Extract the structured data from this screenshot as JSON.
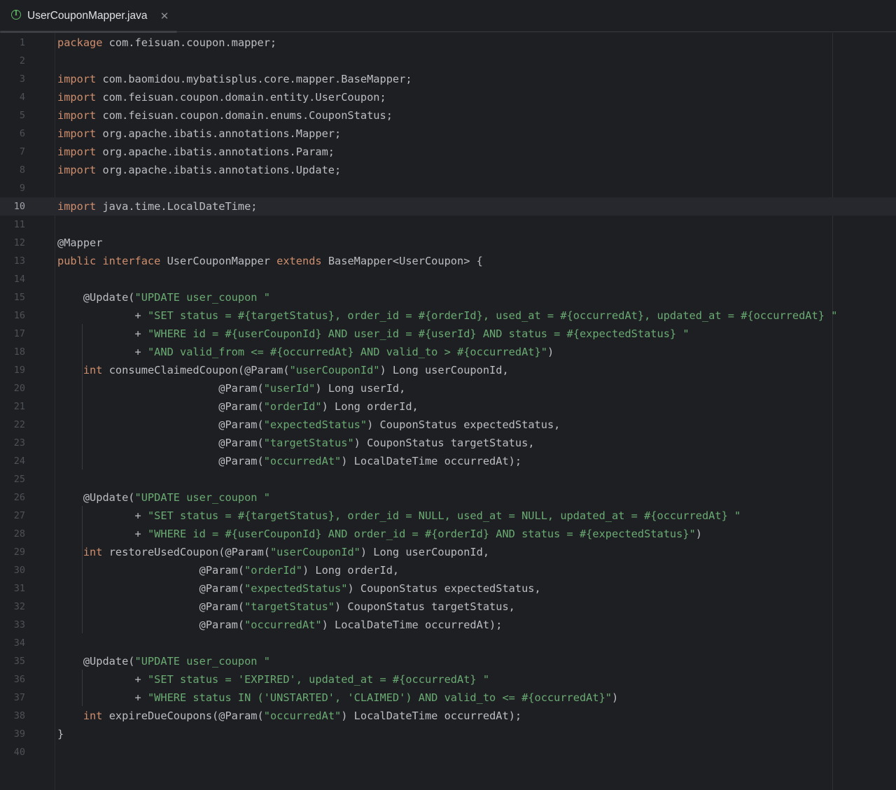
{
  "tab": {
    "title": "UserCouponMapper.java",
    "icon": "interface-icon",
    "icon_glyph": "I",
    "close_glyph": "✕"
  },
  "editor": {
    "current_line": 10,
    "lines": [
      [
        [
          "kw",
          "package"
        ],
        [
          "plain",
          " com.feisuan.coupon.mapper;"
        ]
      ],
      [],
      [
        [
          "kw",
          "import"
        ],
        [
          "plain",
          " com.baomidou.mybatisplus.core.mapper.BaseMapper;"
        ]
      ],
      [
        [
          "kw",
          "import"
        ],
        [
          "plain",
          " com.feisuan.coupon.domain.entity.UserCoupon;"
        ]
      ],
      [
        [
          "kw",
          "import"
        ],
        [
          "plain",
          " com.feisuan.coupon.domain.enums.CouponStatus;"
        ]
      ],
      [
        [
          "kw",
          "import"
        ],
        [
          "plain",
          " org.apache.ibatis.annotations.Mapper;"
        ]
      ],
      [
        [
          "kw",
          "import"
        ],
        [
          "plain",
          " org.apache.ibatis.annotations.Param;"
        ]
      ],
      [
        [
          "kw",
          "import"
        ],
        [
          "plain",
          " org.apache.ibatis.annotations.Update;"
        ]
      ],
      [],
      [
        [
          "kw",
          "import"
        ],
        [
          "plain",
          " java.time.LocalDateTime;"
        ]
      ],
      [],
      [
        [
          "plain",
          "@Mapper"
        ]
      ],
      [
        [
          "kw",
          "public interface"
        ],
        [
          "plain",
          " UserCouponMapper "
        ],
        [
          "kw",
          "extends"
        ],
        [
          "plain",
          " BaseMapper<UserCoupon> {"
        ]
      ],
      [],
      [
        [
          "plain",
          "    @Update("
        ],
        [
          "str",
          "\"UPDATE user_coupon \""
        ]
      ],
      [
        [
          "plain",
          "            + "
        ],
        [
          "str",
          "\"SET status = #{targetStatus}, order_id = #{orderId}, used_at = #{occurredAt}, updated_at = #{occurredAt} \""
        ]
      ],
      [
        [
          "plain",
          "            + "
        ],
        [
          "str",
          "\"WHERE id = #{userCouponId} AND user_id = #{userId} AND status = #{expectedStatus} \""
        ]
      ],
      [
        [
          "plain",
          "            + "
        ],
        [
          "str",
          "\"AND valid_from <= #{occurredAt} AND valid_to > #{occurredAt}\""
        ],
        [
          "plain",
          ")"
        ]
      ],
      [
        [
          "plain",
          "    "
        ],
        [
          "kw",
          "int"
        ],
        [
          "plain",
          " consumeClaimedCoupon(@Param("
        ],
        [
          "str",
          "\"userCouponId\""
        ],
        [
          "plain",
          ") Long userCouponId,"
        ]
      ],
      [
        [
          "plain",
          "                         @Param("
        ],
        [
          "str",
          "\"userId\""
        ],
        [
          "plain",
          ") Long userId,"
        ]
      ],
      [
        [
          "plain",
          "                         @Param("
        ],
        [
          "str",
          "\"orderId\""
        ],
        [
          "plain",
          ") Long orderId,"
        ]
      ],
      [
        [
          "plain",
          "                         @Param("
        ],
        [
          "str",
          "\"expectedStatus\""
        ],
        [
          "plain",
          ") CouponStatus expectedStatus,"
        ]
      ],
      [
        [
          "plain",
          "                         @Param("
        ],
        [
          "str",
          "\"targetStatus\""
        ],
        [
          "plain",
          ") CouponStatus targetStatus,"
        ]
      ],
      [
        [
          "plain",
          "                         @Param("
        ],
        [
          "str",
          "\"occurredAt\""
        ],
        [
          "plain",
          ") LocalDateTime occurredAt);"
        ]
      ],
      [],
      [
        [
          "plain",
          "    @Update("
        ],
        [
          "str",
          "\"UPDATE user_coupon \""
        ]
      ],
      [
        [
          "plain",
          "            + "
        ],
        [
          "str",
          "\"SET status = #{targetStatus}, order_id = NULL, used_at = NULL, updated_at = #{occurredAt} \""
        ]
      ],
      [
        [
          "plain",
          "            + "
        ],
        [
          "str",
          "\"WHERE id = #{userCouponId} AND order_id = #{orderId} AND status = #{expectedStatus}\""
        ],
        [
          "plain",
          ")"
        ]
      ],
      [
        [
          "plain",
          "    "
        ],
        [
          "kw",
          "int"
        ],
        [
          "plain",
          " restoreUsedCoupon(@Param("
        ],
        [
          "str",
          "\"userCouponId\""
        ],
        [
          "plain",
          ") Long userCouponId,"
        ]
      ],
      [
        [
          "plain",
          "                      @Param("
        ],
        [
          "str",
          "\"orderId\""
        ],
        [
          "plain",
          ") Long orderId,"
        ]
      ],
      [
        [
          "plain",
          "                      @Param("
        ],
        [
          "str",
          "\"expectedStatus\""
        ],
        [
          "plain",
          ") CouponStatus expectedStatus,"
        ]
      ],
      [
        [
          "plain",
          "                      @Param("
        ],
        [
          "str",
          "\"targetStatus\""
        ],
        [
          "plain",
          ") CouponStatus targetStatus,"
        ]
      ],
      [
        [
          "plain",
          "                      @Param("
        ],
        [
          "str",
          "\"occurredAt\""
        ],
        [
          "plain",
          ") LocalDateTime occurredAt);"
        ]
      ],
      [],
      [
        [
          "plain",
          "    @Update("
        ],
        [
          "str",
          "\"UPDATE user_coupon \""
        ]
      ],
      [
        [
          "plain",
          "            + "
        ],
        [
          "str",
          "\"SET status = 'EXPIRED', updated_at = #{occurredAt} \""
        ]
      ],
      [
        [
          "plain",
          "            + "
        ],
        [
          "str",
          "\"WHERE status IN ('UNSTARTED', 'CLAIMED') AND valid_to <= #{occurredAt}\""
        ],
        [
          "plain",
          ")"
        ]
      ],
      [
        [
          "plain",
          "    "
        ],
        [
          "kw",
          "int"
        ],
        [
          "plain",
          " expireDueCoupons(@Param("
        ],
        [
          "str",
          "\"occurredAt\""
        ],
        [
          "plain",
          ") LocalDateTime occurredAt);"
        ]
      ],
      [
        [
          "plain",
          "}"
        ]
      ],
      []
    ]
  },
  "colors": {
    "keyword": "#cf8e6d",
    "string": "#6aab73",
    "plain": "#bcbec4",
    "background": "#1e1f22",
    "line_number": "#4e5157"
  }
}
